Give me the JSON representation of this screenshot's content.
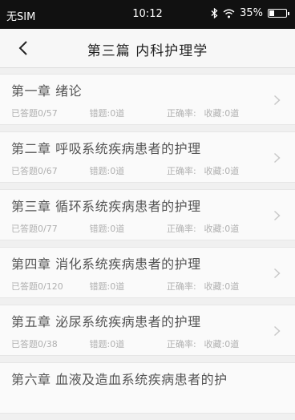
{
  "status": {
    "carrier": "无SIM",
    "time": "10:12",
    "battery": "35%"
  },
  "nav": {
    "title": "第三篇 内科护理学"
  },
  "chapters": [
    {
      "title": "第一章  绪论",
      "answered": "已答题0/57",
      "wrong": "错题:0道",
      "accuracy": "正确率:",
      "favorites": "收藏:0道"
    },
    {
      "title": "第二章  呼吸系统疾病患者的护理",
      "answered": "已答题0/67",
      "wrong": "错题:0道",
      "accuracy": "正确率:",
      "favorites": "收藏:0道"
    },
    {
      "title": "第三章  循环系统疾病患者的护理",
      "answered": "已答题0/77",
      "wrong": "错题:0道",
      "accuracy": "正确率:",
      "favorites": "收藏:0道"
    },
    {
      "title": "第四章  消化系统疾病患者的护理",
      "answered": "已答题0/120",
      "wrong": "错题:0道",
      "accuracy": "正确率:",
      "favorites": "收藏:0道"
    },
    {
      "title": "第五章  泌尿系统疾病患者的护理",
      "answered": "已答题0/38",
      "wrong": "错题:0道",
      "accuracy": "正确率:",
      "favorites": "收藏:0道"
    },
    {
      "title": "第六章  血液及造血系统疾病患者的护",
      "answered": "",
      "wrong": "",
      "accuracy": "",
      "favorites": ""
    }
  ],
  "icons": {
    "back": "chevron-left-icon",
    "row_arrow": "chevron-right-icon",
    "bluetooth": "bluetooth-icon",
    "wifi": "wifi-icon",
    "battery": "battery-icon"
  },
  "colors": {
    "status_bar_bg": "#111111",
    "nav_bg": "#f7f7f7",
    "page_bg": "#f0f0f0",
    "meta_text": "#b0b0b0"
  }
}
